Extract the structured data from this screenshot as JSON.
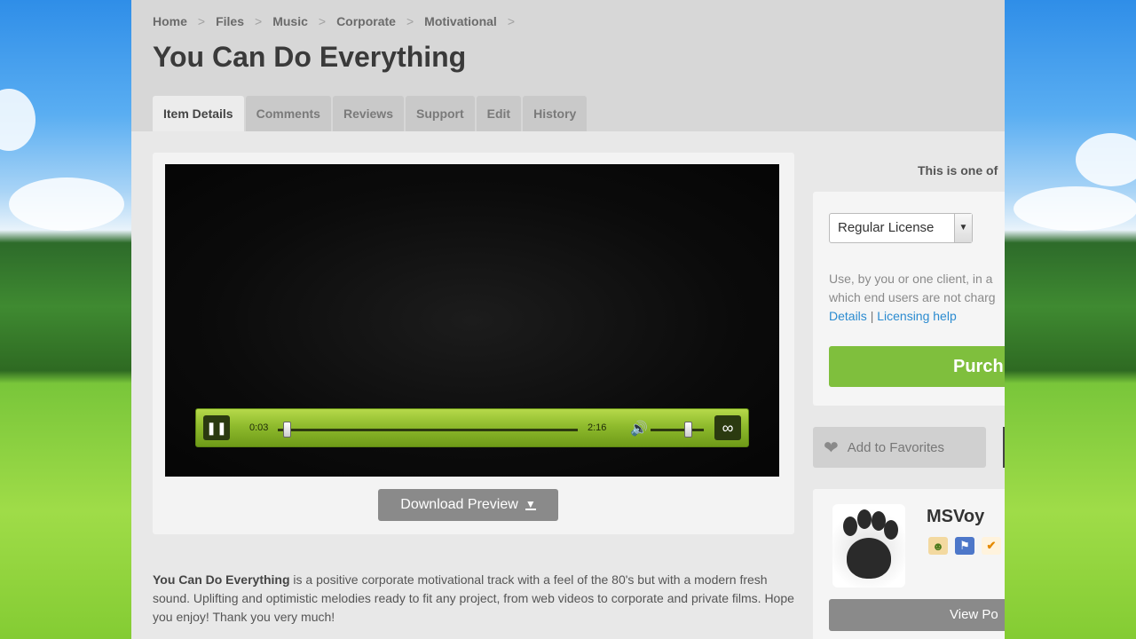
{
  "breadcrumb": [
    "Home",
    "Files",
    "Music",
    "Corporate",
    "Motivational"
  ],
  "page_title": "You Can Do Everything",
  "tabs": [
    "Item Details",
    "Comments",
    "Reviews",
    "Support",
    "Edit",
    "History"
  ],
  "player": {
    "current_time": "0:03",
    "duration": "2:16",
    "progress": 0.02,
    "volume": 0.7
  },
  "download_label": "Download Preview",
  "description": {
    "title": "You Can Do Everything",
    "text": " is a positive corporate motivational track with a feel of the 80's but with a modern fresh sound. Uplifting and optimistic melodies ready to fit any project, from web videos to corporate and private films. Hope you enjoy! Thank you very much!"
  },
  "side_note": "This is one of",
  "license": {
    "selected": "Regular License",
    "text_line1": "Use, by you or one client, in a",
    "text_line2": "which end users are not charg",
    "details_link": "Details",
    "separator": "|",
    "help_link": "Licensing help",
    "purchase_label": "Purch"
  },
  "favorites_label": "Add to Favorites",
  "author": {
    "name": "MSVoy",
    "portfolio_label": "View Po"
  },
  "colors": {
    "accent_green": "#7fbf3d",
    "link_blue": "#2b8bd0"
  }
}
